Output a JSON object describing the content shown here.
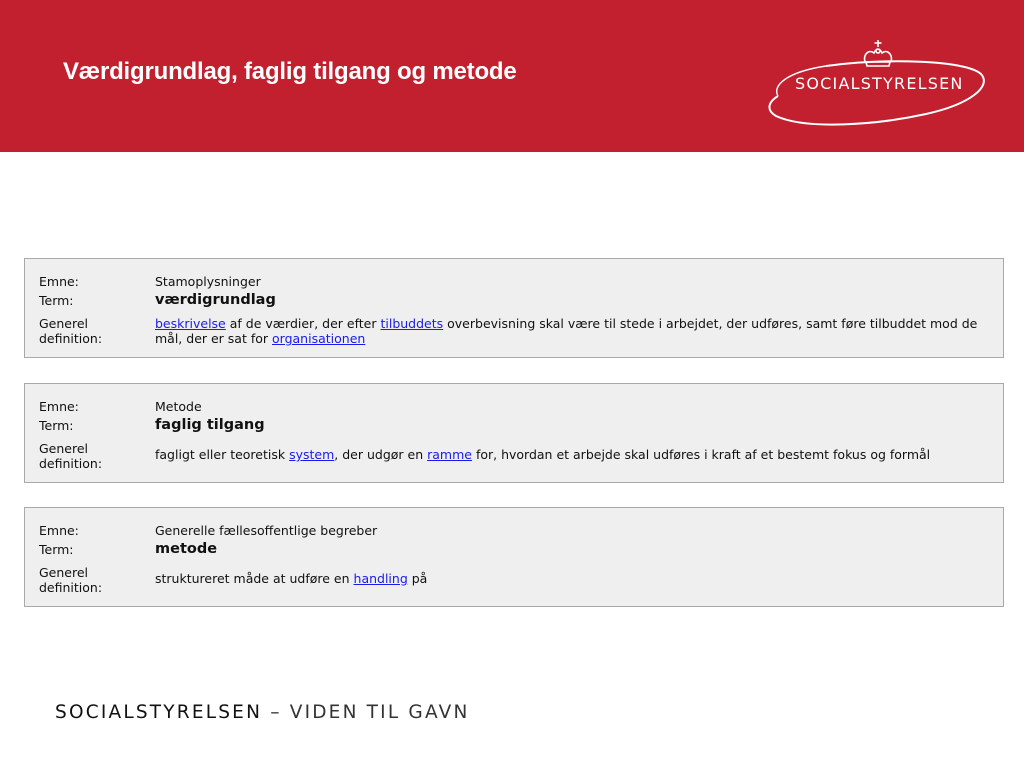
{
  "header": {
    "title": "Værdigrundlag, faglig tilgang og metode",
    "logo_text": "SOCIALSTYRELSEN",
    "background_color": "#c21f2f"
  },
  "labels": {
    "subject": "Emne:",
    "term": "Term:",
    "definition_line1": "Generel",
    "definition_line2": "definition:"
  },
  "entries": [
    {
      "subject": "Stamoplysninger",
      "term": "værdigrundlag",
      "definition": [
        {
          "text": "beskrivelse",
          "link": true
        },
        {
          "text": " af de værdier, der efter ",
          "link": false
        },
        {
          "text": "tilbuddets",
          "link": true
        },
        {
          "text": " overbevisning skal være til stede i arbejdet, der udføres, samt føre tilbuddet mod de mål, der er sat for ",
          "link": false
        },
        {
          "text": "organisationen",
          "link": true
        }
      ]
    },
    {
      "subject": "Metode",
      "term": "faglig tilgang",
      "definition": [
        {
          "text": "fagligt eller teoretisk ",
          "link": false
        },
        {
          "text": "system",
          "link": true
        },
        {
          "text": ", der udgør en ",
          "link": false
        },
        {
          "text": "ramme",
          "link": true
        },
        {
          "text": " for, hvordan et arbejde skal udføres i kraft af et bestemt fokus og formål",
          "link": false
        }
      ]
    },
    {
      "subject": "Generelle fællesoffentlige begreber",
      "term": "metode",
      "definition": [
        {
          "text": "struktureret måde at udføre en ",
          "link": false
        },
        {
          "text": "handling",
          "link": true
        },
        {
          "text": " på",
          "link": false
        }
      ]
    }
  ],
  "footer": {
    "brand": "SOCIALSTYRELSEN",
    "tagline": " – VIDEN TIL GAVN"
  }
}
